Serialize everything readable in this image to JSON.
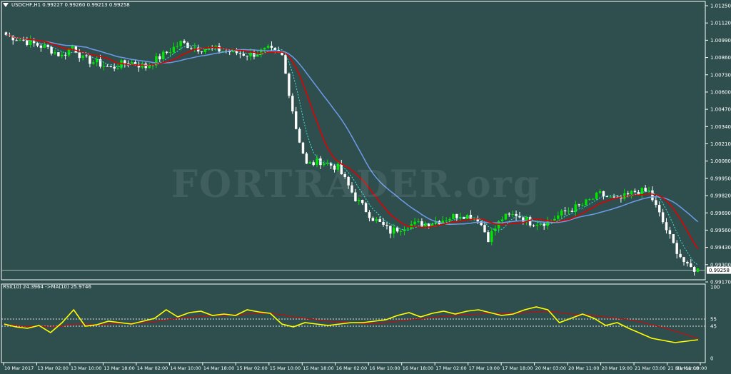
{
  "header": {
    "symbol_info": "USDCHF,H1  0.99227 0.99260 0.99213 0.99258",
    "rsi_info": "RSI(10) 24.3964  ->MA(10) 25.9746"
  },
  "watermark": "FORTRADER.org",
  "price_axis": {
    "min": 0.9917,
    "max": 1.0125,
    "ticks": [
      "1.01250",
      "1.01120",
      "1.00990",
      "1.00860",
      "1.00730",
      "1.00600",
      "1.00470",
      "1.00340",
      "1.00210",
      "1.00080",
      "0.99950",
      "0.99820",
      "0.99690",
      "0.99560",
      "0.99430",
      "0.99300",
      "0.99170"
    ],
    "current_price": "0.99258"
  },
  "rsi_axis": {
    "ticks": [
      "100",
      "55",
      "45",
      "0"
    ],
    "levels": [
      55,
      45
    ]
  },
  "time_axis": {
    "labels": [
      "10 Mar 2017",
      "13 Mar 02:00",
      "13 Mar 10:00",
      "13 Mar 18:00",
      "14 Mar 02:00",
      "14 Mar 10:00",
      "14 Mar 18:00",
      "15 Mar 02:00",
      "15 Mar 10:00",
      "15 Mar 18:00",
      "16 Mar 02:00",
      "16 Mar 10:00",
      "16 Mar 18:00",
      "17 Mar 02:00",
      "17 Mar 10:00",
      "17 Mar 18:00",
      "20 Mar 03:00",
      "20 Mar 11:00",
      "20 Mar 19:00",
      "21 Mar 03:00",
      "21 Mar 11:00",
      "21 Mar 19:00"
    ]
  },
  "colors": {
    "background": "#2f4f4f",
    "bull": "#00e600",
    "bear": "#ffffff",
    "ma_fast": "#e00000",
    "ma_slow": "#6e9be8",
    "ma_dotted": "#40e0d0",
    "rsi": "#ffff00",
    "rsi_ma": "#e00000"
  },
  "chart_data": {
    "type": "candlestick",
    "close_path": [
      [
        0,
        1.0103
      ],
      [
        6,
        1.0098
      ],
      [
        12,
        1.0093
      ],
      [
        16,
        1.0087
      ],
      [
        19,
        1.0095
      ],
      [
        22,
        1.0085
      ],
      [
        26,
        1.0082
      ],
      [
        30,
        1.0078
      ],
      [
        35,
        1.0083
      ],
      [
        40,
        1.0079
      ],
      [
        45,
        1.0088
      ],
      [
        50,
        1.0097
      ],
      [
        55,
        1.0093
      ],
      [
        60,
        1.0092
      ],
      [
        65,
        1.009
      ],
      [
        70,
        1.0088
      ],
      [
        75,
        1.0092
      ],
      [
        79,
        1.0087
      ],
      [
        83,
        1.0033
      ],
      [
        86,
        1.0005
      ],
      [
        90,
        1.0008
      ],
      [
        95,
        1.0003
      ],
      [
        100,
        0.998
      ],
      [
        105,
        0.9965
      ],
      [
        110,
        0.9955
      ],
      [
        115,
        0.996
      ],
      [
        120,
        0.9961
      ],
      [
        125,
        0.9964
      ],
      [
        130,
        0.9968
      ],
      [
        135,
        0.9965
      ],
      [
        138,
        0.995
      ],
      [
        142,
        0.9965
      ],
      [
        146,
        0.9968
      ],
      [
        150,
        0.9962
      ],
      [
        155,
        0.9962
      ],
      [
        160,
        0.997
      ],
      [
        165,
        0.9975
      ],
      [
        170,
        0.9983
      ],
      [
        175,
        0.9978
      ],
      [
        180,
        0.9985
      ],
      [
        184,
        0.9985
      ],
      [
        188,
        0.9962
      ],
      [
        191,
        0.9945
      ],
      [
        195,
        0.9928
      ],
      [
        198,
        0.9926
      ]
    ],
    "bars": 199,
    "rsi_values": [
      48,
      44,
      42,
      46,
      36,
      50,
      68,
      45,
      47,
      52,
      50,
      48,
      52,
      56,
      68,
      58,
      64,
      66,
      60,
      62,
      60,
      68,
      65,
      63,
      48,
      44,
      50,
      48,
      46,
      48,
      50,
      50,
      52,
      54,
      60,
      64,
      58,
      63,
      66,
      62,
      66,
      68,
      64,
      60,
      62,
      68,
      72,
      68,
      50,
      56,
      62,
      56,
      46,
      50,
      42,
      35,
      28,
      25,
      22,
      24,
      26
    ],
    "rsi_ma_values": [
      47,
      46,
      45,
      45,
      44,
      45,
      48,
      48,
      47,
      48,
      49,
      49,
      50,
      51,
      54,
      56,
      57,
      59,
      60,
      60,
      61,
      62,
      63,
      63,
      61,
      58,
      56,
      54,
      52,
      51,
      50,
      49,
      49,
      50,
      52,
      54,
      55,
      57,
      59,
      60,
      61,
      62,
      63,
      63,
      63,
      64,
      65,
      66,
      64,
      62,
      61,
      60,
      58,
      56,
      54,
      51,
      47,
      43,
      38,
      33,
      28
    ]
  }
}
